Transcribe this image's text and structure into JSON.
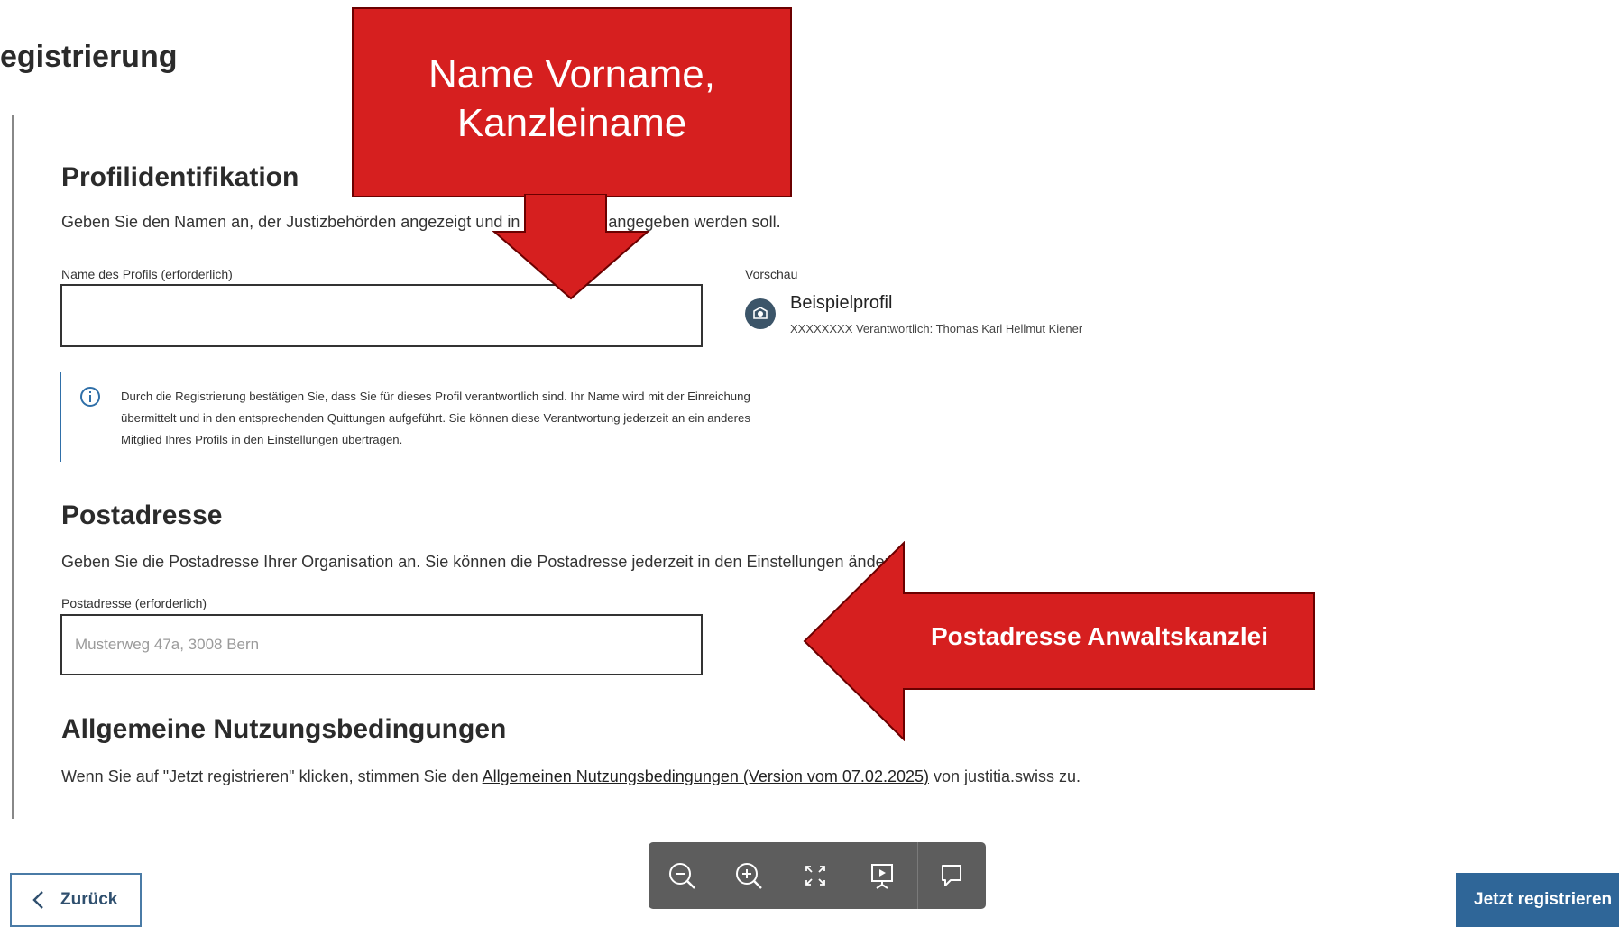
{
  "page": {
    "title": "egistrierung"
  },
  "profile": {
    "heading": "Profilidentifikation",
    "description": "Geben Sie den Namen an, der Justizbehörden angezeigt und in Quittungen angegeben werden soll.",
    "field_label": "Name des Profils (erforderlich)",
    "field_value": "",
    "preview_label": "Vorschau",
    "preview_name": "Beispielprofil",
    "preview_meta": "XXXXXXXX  Verantwortlich: Thomas Karl Hellmut Kiener",
    "info_text": "Durch die Registrierung bestätigen Sie, dass Sie für dieses Profil verantwortlich sind. Ihr Name wird mit der Einreichung übermittelt und in den entsprechenden Quittungen aufgeführt. Sie können diese Verantwortung jederzeit an ein anderes Mitglied Ihres Profils in den Einstellungen übertragen."
  },
  "address": {
    "heading": "Postadresse",
    "description": "Geben Sie die Postadresse Ihrer Organisation an. Sie können die Postadresse jederzeit in den Einstellungen ändern.",
    "field_label": "Postadresse (erforderlich)",
    "field_placeholder": "Musterweg 47a, 3008 Bern"
  },
  "terms": {
    "heading": "Allgemeine Nutzungsbedingungen",
    "text_before": "Wenn Sie auf \"Jetzt registrieren\" klicken, stimmen Sie den ",
    "link": "Allgemeinen Nutzungsbedingungen (Version vom 07.02.2025)",
    "text_after": " von justitia.swiss zu."
  },
  "footer": {
    "back_label": "Zurück",
    "register_label": "Jetzt registrieren"
  },
  "annotations": {
    "callout_1": "Name Vorname, Kanzleiname",
    "callout_2": "Postadresse Anwaltskanzlei",
    "color": "#d61f1f"
  },
  "viewer_toolbar": {
    "icons": [
      "zoom-out-icon",
      "zoom-in-icon",
      "fullscreen-icon",
      "presentation-icon",
      "comment-icon"
    ]
  },
  "colors": {
    "accent": "#2f6698",
    "info_border": "#2f6fa8"
  }
}
